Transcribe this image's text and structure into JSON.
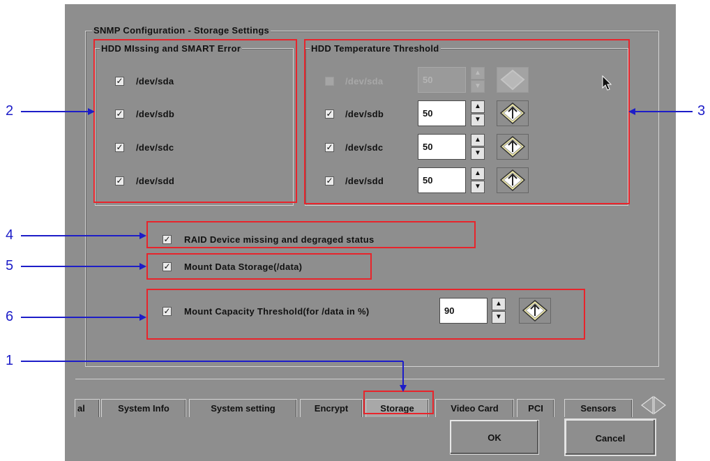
{
  "window": {
    "group_title": "SNMP Configuration - Storage Settings"
  },
  "hdd_missing": {
    "title": "HDD MIssing and SMART Error",
    "items": [
      {
        "label": "/dev/sda",
        "checked": true
      },
      {
        "label": "/dev/sdb",
        "checked": true
      },
      {
        "label": "/dev/sdc",
        "checked": true
      },
      {
        "label": "/dev/sdd",
        "checked": true
      }
    ]
  },
  "hdd_temp": {
    "title": "HDD Temperature Threshold",
    "items": [
      {
        "label": "/dev/sda",
        "value": "50",
        "enabled": false
      },
      {
        "label": "/dev/sdb",
        "value": "50",
        "enabled": true
      },
      {
        "label": "/dev/sdc",
        "value": "50",
        "enabled": true
      },
      {
        "label": "/dev/sdd",
        "value": "50",
        "enabled": true
      }
    ],
    "check_mark": "☑",
    "spin_up": "▲",
    "spin_down": "▼"
  },
  "raid": {
    "label": "RAID Device missing and degraged status",
    "checked": true
  },
  "mount_data": {
    "label": "Mount Data Storage(/data)",
    "checked": true
  },
  "mount_capacity": {
    "label": "Mount Capacity Threshold(for /data in %)",
    "value": "90",
    "checked": true
  },
  "tabs": [
    {
      "label": "al"
    },
    {
      "label": "System Info"
    },
    {
      "label": "System setting"
    },
    {
      "label": "Encrypt"
    },
    {
      "label": "Storage",
      "active": true
    },
    {
      "label": "Video Card"
    },
    {
      "label": "PCI"
    },
    {
      "label": "Sensors"
    }
  ],
  "buttons": {
    "ok": "OK",
    "cancel": "Cancel"
  },
  "callouts": {
    "c1": "1",
    "c2": "2",
    "c3": "3",
    "c4": "4",
    "c5": "5",
    "c6": "6"
  },
  "colors": {
    "annotation_red": "#e8242b",
    "annotation_blue": "#1d1dc8",
    "panel_gray": "#8e8e8e"
  },
  "icons": [
    "check-icon",
    "spin-up-icon",
    "spin-down-icon",
    "apply-icon",
    "mouse-cursor-icon",
    "scroll-left-icon",
    "scroll-right-icon"
  ]
}
